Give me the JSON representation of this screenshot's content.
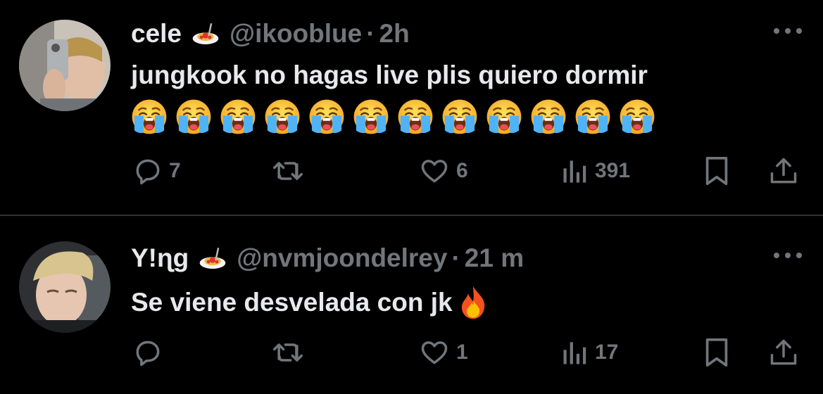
{
  "tweets": [
    {
      "display_name": "cele",
      "handle": "@ikooblue",
      "separator": "·",
      "time": "2h",
      "text": "jungkook no hagas live plis quiero dormir",
      "emoji_count_label": "😭😭😭😭😭😭😭😭😭😭😭😭",
      "replies": "7",
      "retweets": "",
      "likes": "6",
      "views": "391"
    },
    {
      "display_name": "Y!ɳg",
      "handle": "@nvmjoondelrey",
      "separator": "·",
      "time": "21 m",
      "text": "Se viene desvelada con jk",
      "replies": "",
      "retweets": "",
      "likes": "1",
      "views": "17"
    }
  ],
  "icons": {
    "reply": "reply-icon",
    "retweet": "retweet-icon",
    "like": "heart-icon",
    "views": "views-icon",
    "bookmark": "bookmark-icon",
    "share": "share-icon",
    "more": "more-icon",
    "name_emoji": "spaghetti-icon",
    "cry": "crying-face-icon",
    "fire": "fire-icon"
  },
  "colors": {
    "background": "#000000",
    "text": "#e7e9ea",
    "secondary": "#71767b",
    "divider": "#2f3336"
  }
}
